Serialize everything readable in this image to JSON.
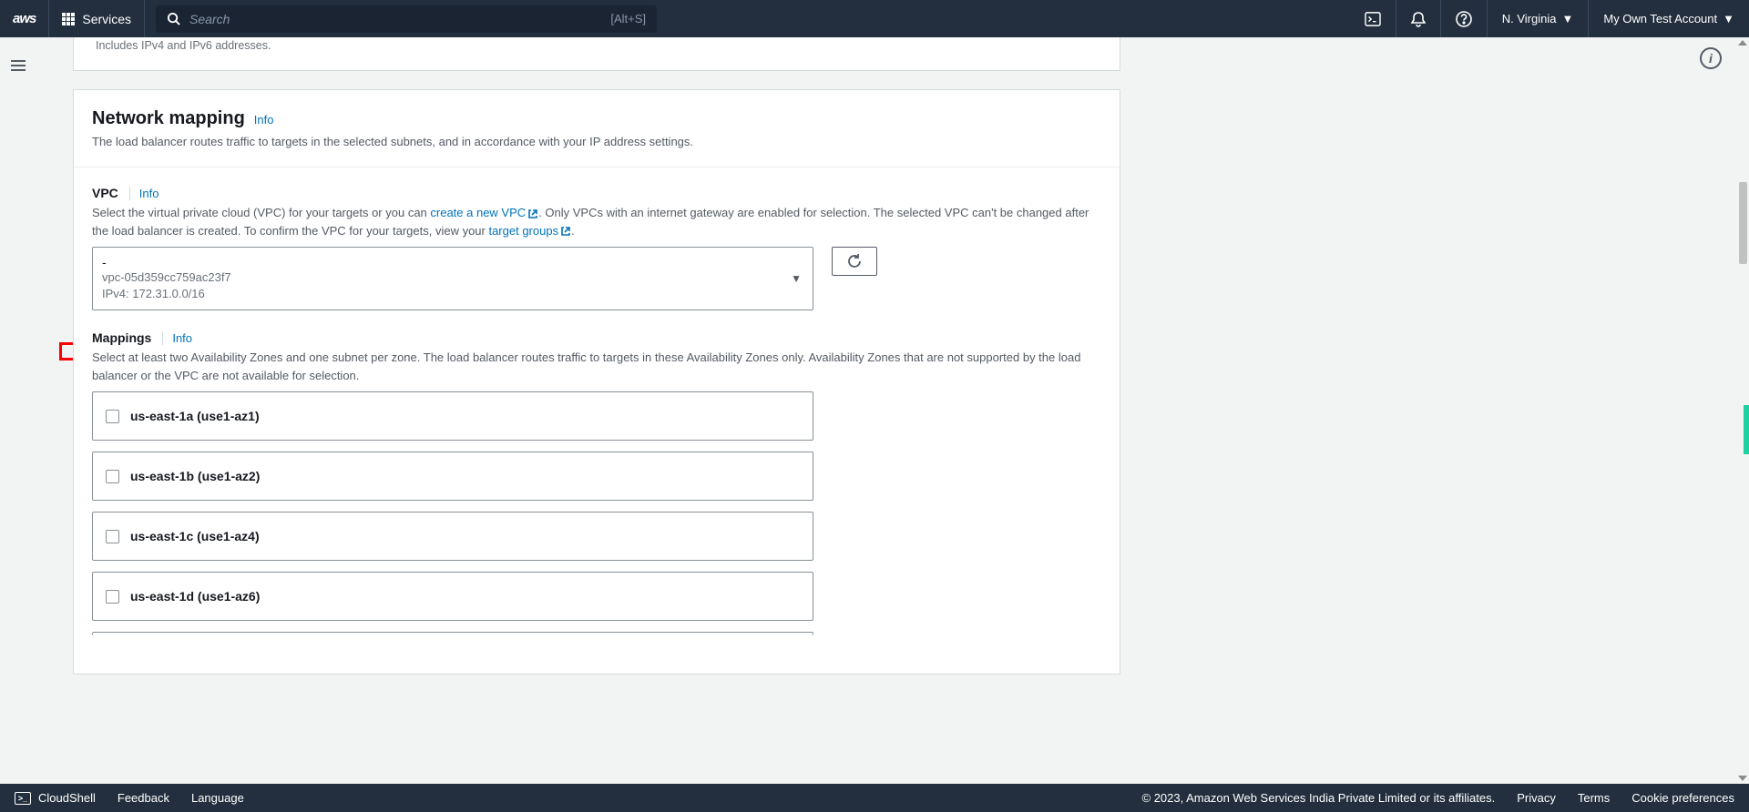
{
  "nav": {
    "logo": "aws",
    "services": "Services",
    "searchPlaceholder": "Search",
    "searchHint": "[Alt+S]",
    "region": "N. Virginia",
    "account": "My Own Test Account"
  },
  "fragment": {
    "helper": "Includes IPv4 and IPv6 addresses."
  },
  "panel": {
    "title": "Network mapping",
    "info": "Info",
    "desc": "The load balancer routes traffic to targets in the selected subnets, and in accordance with your IP address settings."
  },
  "vpc": {
    "label": "VPC",
    "info": "Info",
    "desc1": "Select the virtual private cloud (VPC) for your targets or you can ",
    "createLink": "create a new VPC",
    "desc2": ". Only VPCs with an internet gateway are enabled for selection. The selected VPC can't be changed after the load balancer is created. To confirm the VPC for your targets, view your ",
    "targetGroupsLink": "target groups",
    "desc3": ".",
    "select": {
      "dash": "-",
      "id": "vpc-05d359cc759ac23f7",
      "cidr": "IPv4: 172.31.0.0/16"
    }
  },
  "mappings": {
    "label": "Mappings",
    "info": "Info",
    "desc": "Select at least two Availability Zones and one subnet per zone. The load balancer routes traffic to targets in these Availability Zones only. Availability Zones that are not supported by the load balancer or the VPC are not available for selection.",
    "zones": [
      "us-east-1a (use1-az1)",
      "us-east-1b (use1-az2)",
      "us-east-1c (use1-az4)",
      "us-east-1d (use1-az6)"
    ]
  },
  "footer": {
    "cloudshell": "CloudShell",
    "feedback": "Feedback",
    "language": "Language",
    "copyright": "© 2023, Amazon Web Services India Private Limited or its affiliates.",
    "privacy": "Privacy",
    "terms": "Terms",
    "cookie": "Cookie preferences"
  }
}
